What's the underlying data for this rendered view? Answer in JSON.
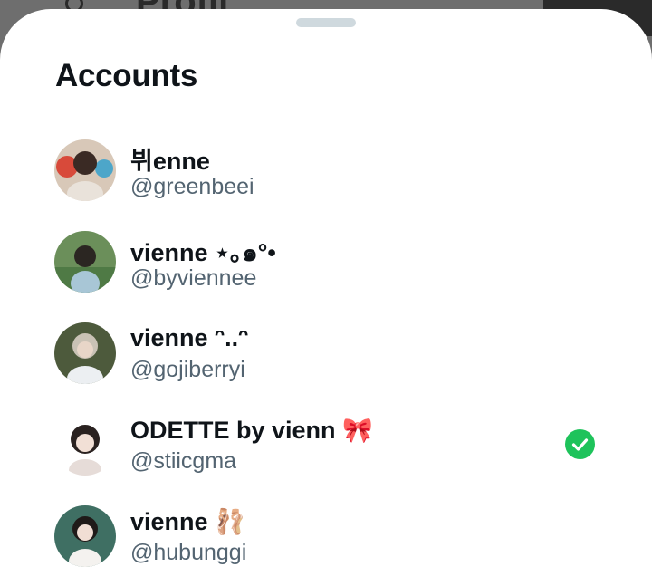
{
  "background": {
    "title_fragment": "Profil"
  },
  "sheet": {
    "title": "Accounts"
  },
  "accounts": [
    {
      "name": "뷔enne",
      "handle": "@greenbeei",
      "selected": false,
      "avatar_color": "#c9b7a8"
    },
    {
      "name": "vienne ⋆｡๑°•",
      "handle": "@byviennee",
      "selected": false,
      "avatar_color": "#6b8f5a"
    },
    {
      "name": "vienne ᵔ..ᵔ",
      "handle": "@gojiberryi",
      "selected": false,
      "avatar_color": "#4d5a3c"
    },
    {
      "name": "ODETTE by vienn 🎀",
      "handle": "@stiicgma",
      "selected": true,
      "avatar_color": "#efe4df"
    },
    {
      "name": "vienne 🩰",
      "handle": "@hubunggi",
      "selected": false,
      "avatar_color": "#3f6f63"
    }
  ],
  "colors": {
    "selected_check": "#1ec35b",
    "handle_text": "#536471",
    "name_text": "#0f1419"
  }
}
